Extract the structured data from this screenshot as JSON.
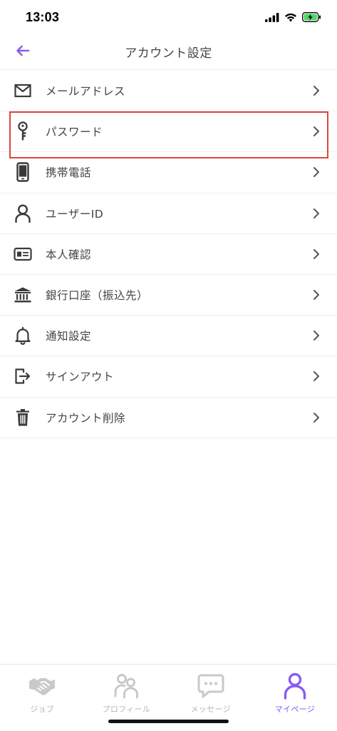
{
  "status": {
    "time": "13:03"
  },
  "header": {
    "title": "アカウント設定",
    "back_icon": "arrow-left-icon",
    "accent": "#8a5cf0"
  },
  "menu": {
    "items": [
      {
        "label": "メールアドレス",
        "icon": "mail-icon"
      },
      {
        "label": "パスワード",
        "icon": "key-icon",
        "highlighted": true
      },
      {
        "label": "携帯電話",
        "icon": "phone-icon"
      },
      {
        "label": "ユーザーID",
        "icon": "user-icon"
      },
      {
        "label": "本人確認",
        "icon": "id-card-icon"
      },
      {
        "label": "銀行口座（振込先）",
        "icon": "bank-icon"
      },
      {
        "label": "通知設定",
        "icon": "bell-icon"
      },
      {
        "label": "サインアウト",
        "icon": "sign-out-icon"
      },
      {
        "label": "アカウント削除",
        "icon": "trash-icon"
      }
    ],
    "highlight_color": "#d9483b"
  },
  "tabs": [
    {
      "label": "ジョブ",
      "icon": "handshake-icon",
      "active": false
    },
    {
      "label": "プロフィール",
      "icon": "people-icon",
      "active": false
    },
    {
      "label": "メッセージ",
      "icon": "chat-bubble-icon",
      "active": false
    },
    {
      "label": "マイページ",
      "icon": "person-icon",
      "active": true
    }
  ]
}
